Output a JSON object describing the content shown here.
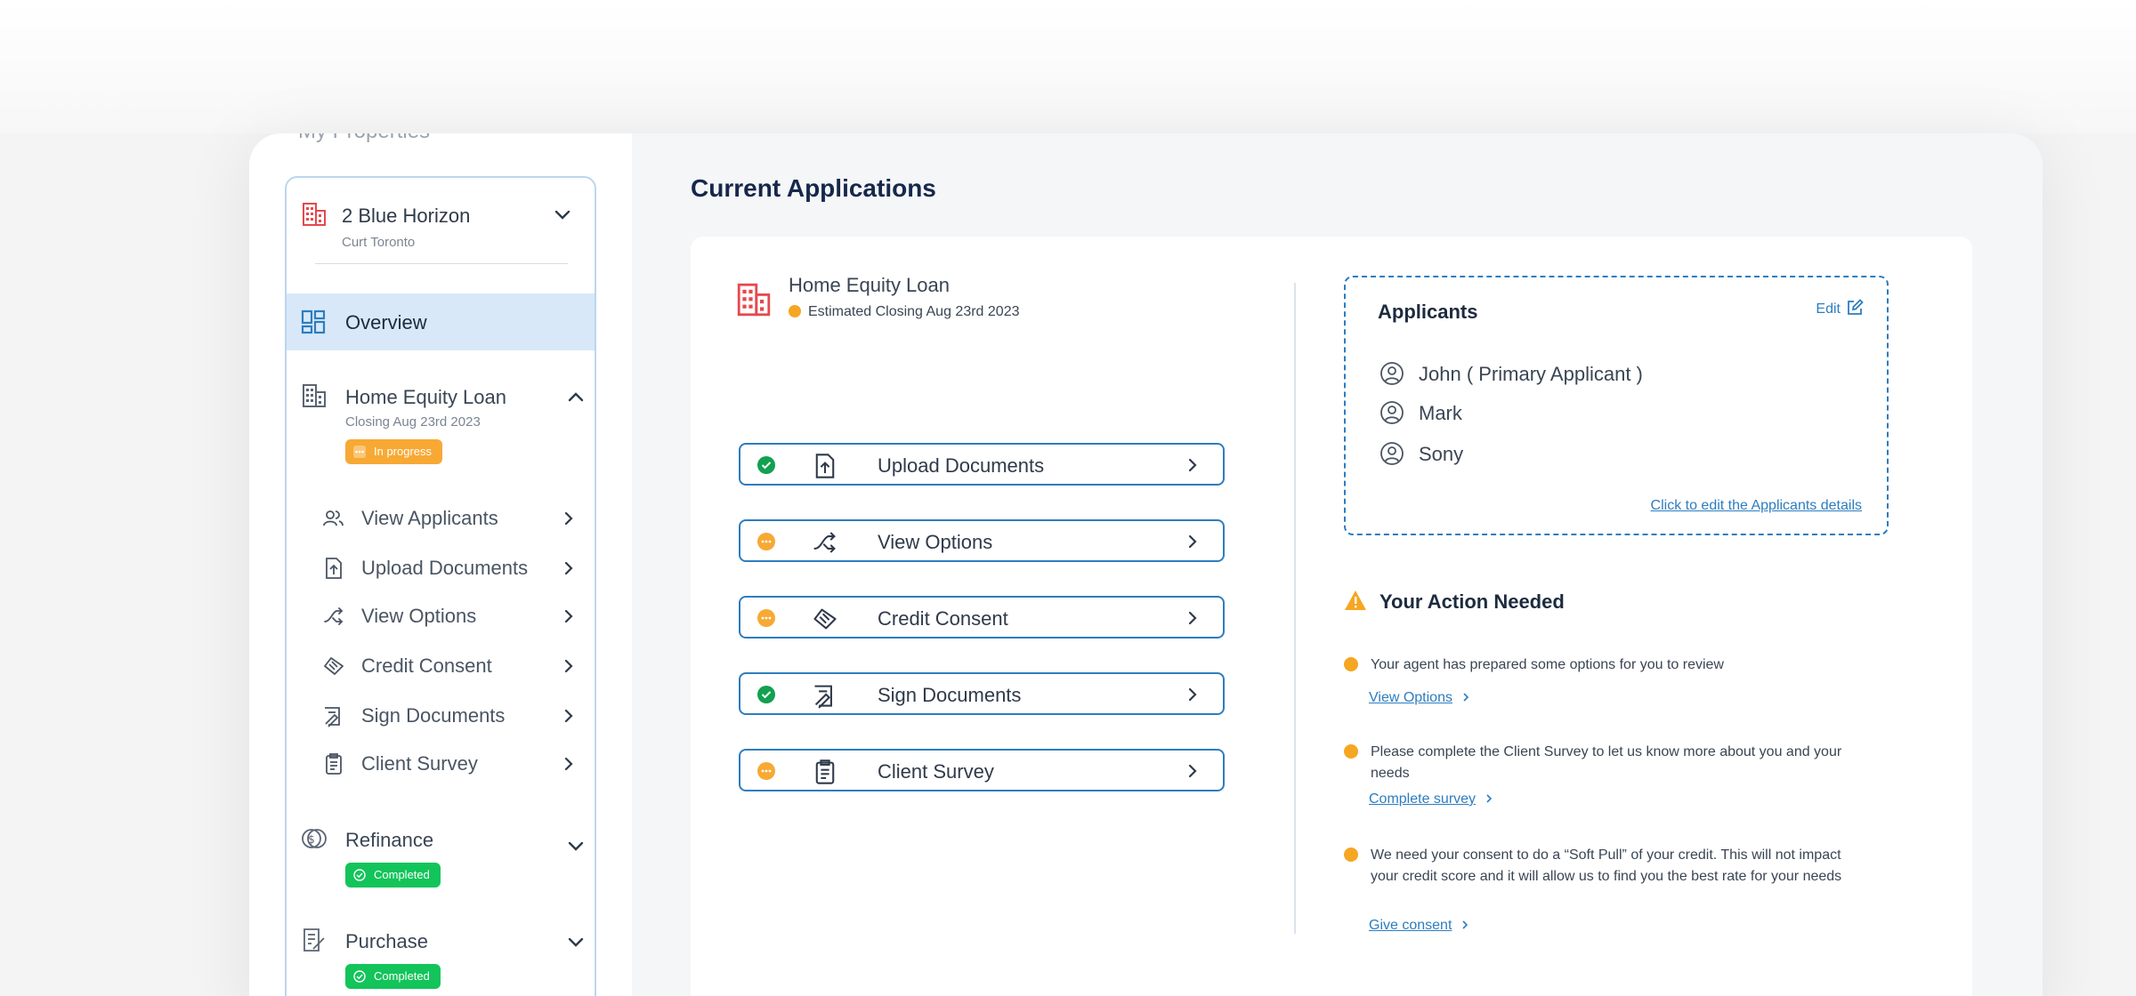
{
  "sidebar": {
    "heading": "My Properties",
    "property": {
      "name": "2 Blue Horizon",
      "location": "Curt Toronto"
    },
    "overview_label": "Overview",
    "groups": [
      {
        "name": "Home Equity Loan",
        "sub": "Closing Aug 23rd 2023",
        "badge": "In progress"
      },
      {
        "name": "Refinance",
        "badge": "Completed"
      },
      {
        "name": "Purchase",
        "badge": "Completed"
      }
    ],
    "subitems": [
      {
        "label": "View Applicants",
        "icon": "users-icon"
      },
      {
        "label": "Upload Documents",
        "icon": "upload-file-icon"
      },
      {
        "label": "View Options",
        "icon": "shuffle-icon"
      },
      {
        "label": "Credit Consent",
        "icon": "handshake-icon"
      },
      {
        "label": "Sign Documents",
        "icon": "sign-document-icon"
      },
      {
        "label": "Client Survey",
        "icon": "clipboard-icon"
      }
    ]
  },
  "main": {
    "title": "Current Applications",
    "loan": {
      "name": "Home Equity Loan",
      "closing": "Estimated Closing Aug 23rd 2023"
    },
    "steps": [
      {
        "label": "Upload Documents",
        "status": "complete"
      },
      {
        "label": "View Options",
        "status": "pending"
      },
      {
        "label": "Credit Consent",
        "status": "pending"
      },
      {
        "label": "Sign Documents",
        "status": "complete"
      },
      {
        "label": "Client Survey",
        "status": "pending"
      }
    ],
    "applicants": {
      "title": "Applicants",
      "edit_label": "Edit",
      "list": [
        "John ( Primary Applicant )",
        "Mark",
        "Sony"
      ],
      "edit_link": "Click to edit the Applicants details"
    },
    "actions": {
      "title": "Your Action Needed",
      "items": [
        {
          "text": "Your agent has prepared some options for you to review",
          "link": "View Options"
        },
        {
          "text": "Please complete the Client Survey to let us know more about you and your needs",
          "link": "Complete survey"
        },
        {
          "text": "We need your consent to do a “Soft Pull” of your credit. This will not impact your credit score and it will allow us to find you the best rate for your needs",
          "link": "Give consent"
        }
      ]
    }
  },
  "colors": {
    "accent": "#2d7dbf",
    "property_icon": "#e5484d",
    "in_progress": "#f7a934",
    "completed": "#12c45a",
    "nav_active_bg": "#d8e8f9"
  }
}
